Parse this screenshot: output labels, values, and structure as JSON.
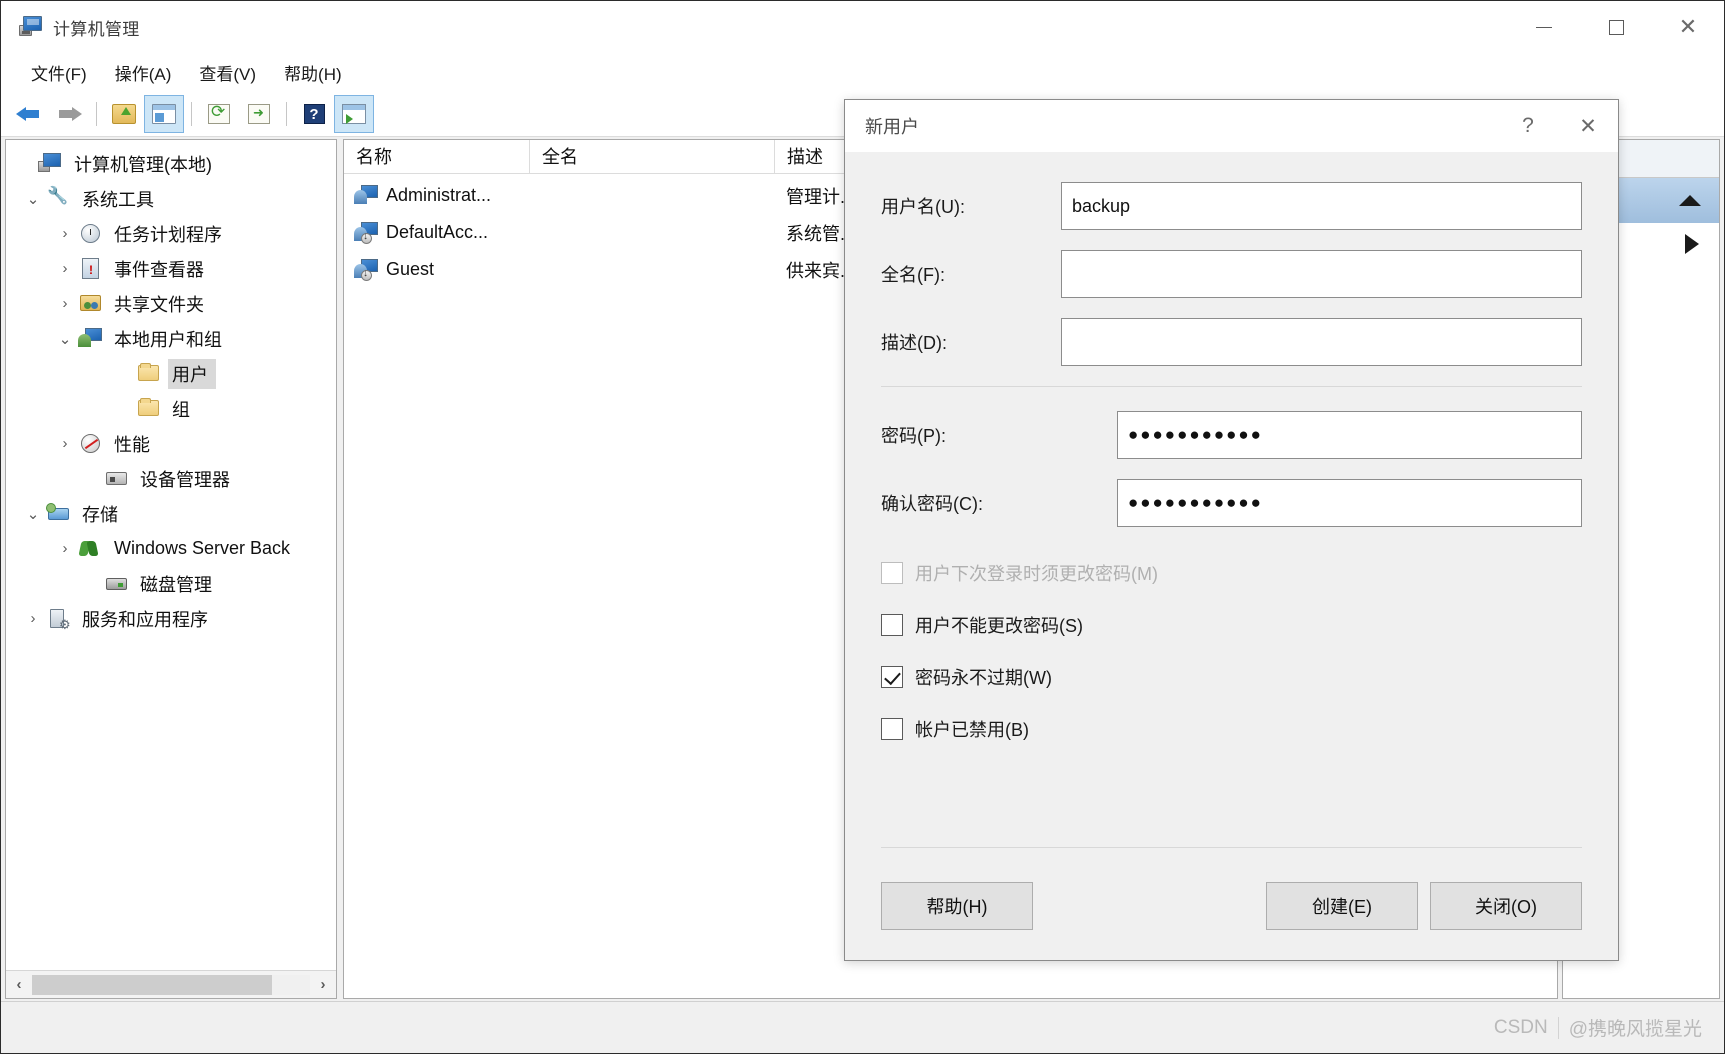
{
  "window": {
    "title": "计算机管理",
    "icon": "computer-management-icon",
    "controls": {
      "minimize": "–",
      "maximize": "□",
      "close": "✕"
    }
  },
  "menubar": {
    "items": [
      {
        "label": "文件(F)",
        "name": "menu-file"
      },
      {
        "label": "操作(A)",
        "name": "menu-action"
      },
      {
        "label": "查看(V)",
        "name": "menu-view"
      },
      {
        "label": "帮助(H)",
        "name": "menu-help"
      }
    ]
  },
  "toolbar": {
    "buttons": [
      {
        "name": "back-button",
        "icon": "arrow-left-icon"
      },
      {
        "name": "forward-button",
        "icon": "arrow-right-icon"
      },
      {
        "name": "up-one-level-button",
        "icon": "folder-up-icon"
      },
      {
        "name": "show-hide-tree-button",
        "icon": "console-tree-icon"
      },
      {
        "name": "refresh-button",
        "icon": "refresh-icon"
      },
      {
        "name": "export-list-button",
        "icon": "export-list-icon"
      },
      {
        "name": "help-button",
        "icon": "question-mark-icon"
      },
      {
        "name": "show-action-pane-button",
        "icon": "action-pane-icon"
      }
    ]
  },
  "tree": {
    "items": [
      {
        "label": "计算机管理(本地)",
        "indent": 0,
        "twisty": "",
        "icon": "computer-icon",
        "selected": false
      },
      {
        "label": "系统工具",
        "indent": 1,
        "twisty": "v",
        "icon": "tools-icon",
        "selected": false
      },
      {
        "label": "任务计划程序",
        "indent": 2,
        "twisty": ">",
        "icon": "clock-icon",
        "selected": false
      },
      {
        "label": "事件查看器",
        "indent": 2,
        "twisty": ">",
        "icon": "event-viewer-icon",
        "selected": false
      },
      {
        "label": "共享文件夹",
        "indent": 2,
        "twisty": ">",
        "icon": "shared-folder-icon",
        "selected": false
      },
      {
        "label": "本地用户和组",
        "indent": 2,
        "twisty": "v",
        "icon": "local-users-groups-icon",
        "selected": false
      },
      {
        "label": "用户",
        "indent": 3,
        "twisty": "",
        "icon": "folder-icon",
        "selected": true
      },
      {
        "label": "组",
        "indent": 3,
        "twisty": "",
        "icon": "folder-icon",
        "selected": false
      },
      {
        "label": "性能",
        "indent": 2,
        "twisty": ">",
        "icon": "performance-icon",
        "selected": false
      },
      {
        "label": "设备管理器",
        "indent": 2,
        "twisty": "",
        "icon": "device-manager-icon",
        "selected": false
      },
      {
        "label": "存储",
        "indent": 1,
        "twisty": "v",
        "icon": "storage-icon",
        "selected": false
      },
      {
        "label": "Windows Server Back",
        "indent": 2,
        "twisty": ">",
        "icon": "backup-icon",
        "selected": false
      },
      {
        "label": "磁盘管理",
        "indent": 2,
        "twisty": "",
        "icon": "disk-management-icon",
        "selected": false
      },
      {
        "label": "服务和应用程序",
        "indent": 1,
        "twisty": ">",
        "icon": "services-icon",
        "selected": false
      }
    ],
    "hscroll": {
      "left_arrow": "‹",
      "right_arrow": "›"
    }
  },
  "list": {
    "columns": [
      {
        "label": "名称",
        "name": "column-name"
      },
      {
        "label": "全名",
        "name": "column-fullname"
      },
      {
        "label": "描述",
        "name": "column-description"
      }
    ],
    "rows": [
      {
        "name": "Administrat...",
        "fullname": "",
        "description": "管理计..."
      },
      {
        "name": "DefaultAcc...",
        "fullname": "",
        "description": "系统管..."
      },
      {
        "name": "Guest",
        "fullname": "",
        "description": "供来宾..."
      }
    ]
  },
  "action_pane": {
    "group_collapse_icon": "triangle-up-icon",
    "item_expand_icon": "triangle-right-icon"
  },
  "dialog": {
    "title": "新用户",
    "help_glyph": "?",
    "close_glyph": "✕",
    "fields": [
      {
        "label": "用户名(U):",
        "value": "backup",
        "name": "username-field"
      },
      {
        "label": "全名(F):",
        "value": "",
        "name": "fullname-field"
      },
      {
        "label": "描述(D):",
        "value": "",
        "name": "description-field"
      }
    ],
    "password_fields": [
      {
        "label": "密码(P):",
        "value": "●●●●●●●●●●●",
        "name": "password-field"
      },
      {
        "label": "确认密码(C):",
        "value": "●●●●●●●●●●●",
        "name": "confirm-password-field"
      }
    ],
    "checkboxes": [
      {
        "label": "用户下次登录时须更改密码(M)",
        "checked": false,
        "disabled": true,
        "name": "must-change-password-checkbox"
      },
      {
        "label": "用户不能更改密码(S)",
        "checked": false,
        "disabled": false,
        "name": "cannot-change-password-checkbox"
      },
      {
        "label": "密码永不过期(W)",
        "checked": true,
        "disabled": false,
        "name": "password-never-expires-checkbox"
      },
      {
        "label": "帐户已禁用(B)",
        "checked": false,
        "disabled": false,
        "name": "account-disabled-checkbox"
      }
    ],
    "buttons": {
      "help": "帮助(H)",
      "create": "创建(E)",
      "close": "关闭(O)"
    }
  },
  "statusbar": {
    "watermark_brand": "CSDN",
    "watermark_user": "@携晚风揽星光"
  }
}
